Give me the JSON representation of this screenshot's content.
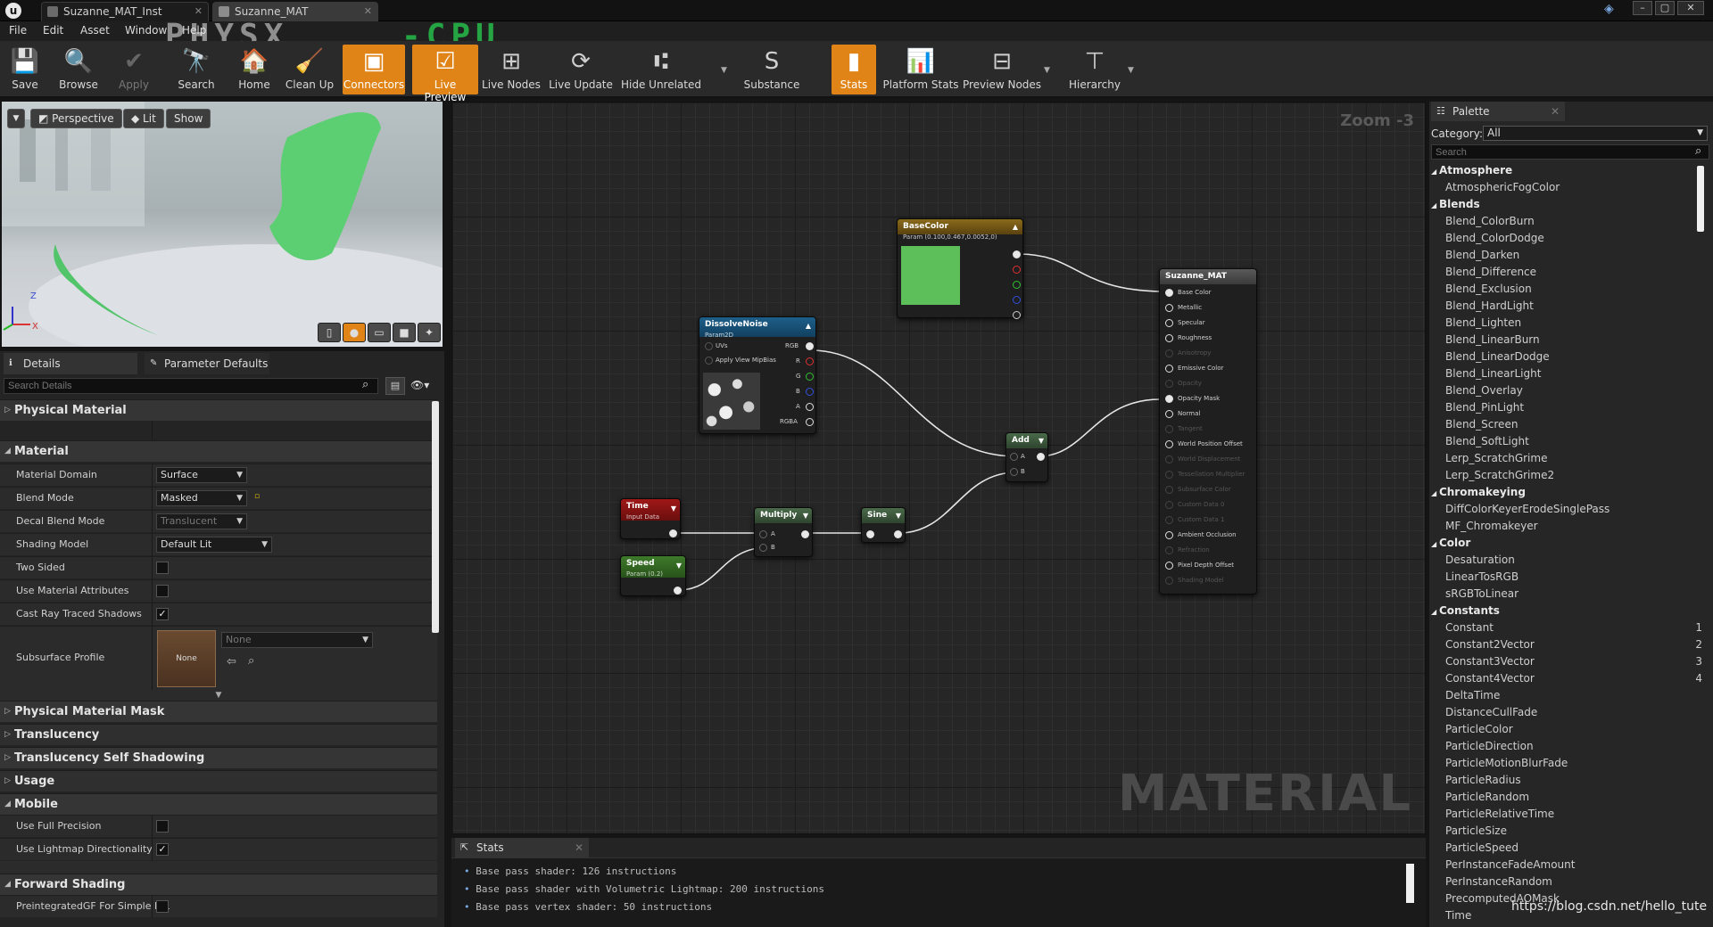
{
  "titlebar": {
    "logo": "u",
    "tabs": [
      "Suzanne_MAT_Inst",
      "Suzanne_MAT"
    ]
  },
  "menu": [
    "File",
    "Edit",
    "Asset",
    "Window",
    "Help"
  ],
  "overlay": {
    "text1": "PHYSX",
    "text2": "-CPU"
  },
  "toolbar": [
    {
      "label": "Save",
      "icon": "save-icon",
      "glyph": "💾",
      "active": false,
      "disabled": false
    },
    {
      "label": "Browse",
      "icon": "browse-icon",
      "glyph": "🔍",
      "active": false,
      "disabled": false
    },
    {
      "label": "Apply",
      "icon": "apply-icon",
      "glyph": "✔",
      "active": false,
      "disabled": true
    },
    {
      "label": "Search",
      "icon": "search-icon",
      "glyph": "🔭",
      "active": false,
      "disabled": false
    },
    {
      "label": "Home",
      "icon": "home-icon",
      "glyph": "🏠",
      "active": false,
      "disabled": false
    },
    {
      "label": "Clean Up",
      "icon": "clean-up-icon",
      "glyph": "🧹",
      "active": false,
      "disabled": false
    },
    {
      "label": "Connectors",
      "icon": "connectors-icon",
      "glyph": "▣",
      "active": true,
      "disabled": false
    },
    {
      "label": "Live Preview",
      "icon": "live-preview-icon",
      "glyph": "☑",
      "active": true,
      "disabled": false
    },
    {
      "label": "Live Nodes",
      "icon": "live-nodes-icon",
      "glyph": "⊞",
      "active": false,
      "disabled": false
    },
    {
      "label": "Live Update",
      "icon": "live-update-icon",
      "glyph": "⟳",
      "active": false,
      "disabled": false
    },
    {
      "label": "Hide Unrelated",
      "icon": "hide-unrelated-icon",
      "glyph": "⑆",
      "active": false,
      "disabled": false
    },
    {
      "label": "Substance",
      "icon": "substance-icon",
      "glyph": "S",
      "active": false,
      "disabled": false
    },
    {
      "label": "Stats",
      "icon": "stats-icon",
      "glyph": "▮",
      "active": true,
      "disabled": false
    },
    {
      "label": "Platform Stats",
      "icon": "platform-stats-icon",
      "glyph": "📊",
      "active": false,
      "disabled": false
    },
    {
      "label": "Preview Nodes",
      "icon": "preview-nodes-icon",
      "glyph": "⊟",
      "active": false,
      "disabled": false
    },
    {
      "label": "Hierarchy",
      "icon": "hierarchy-icon",
      "glyph": "⊤",
      "active": false,
      "disabled": false
    }
  ],
  "viewport": {
    "perspective": "Perspective",
    "lit": "Lit",
    "show": "Show",
    "axis_z": "Z",
    "axis_x": "X"
  },
  "details": {
    "tabs": [
      "Details",
      "Parameter Defaults"
    ],
    "search_placeholder": "Search Details",
    "physical_material": "Physical Material",
    "material": "Material",
    "props": {
      "material_domain": {
        "label": "Material Domain",
        "value": "Surface"
      },
      "blend_mode": {
        "label": "Blend Mode",
        "value": "Masked"
      },
      "decal_blend_mode": {
        "label": "Decal Blend Mode",
        "value": "Translucent"
      },
      "shading_model": {
        "label": "Shading Model",
        "value": "Default Lit"
      },
      "two_sided": {
        "label": "Two Sided",
        "checked": false
      },
      "use_material_attributes": {
        "label": "Use Material Attributes",
        "checked": false
      },
      "cast_ray_traced_shadows": {
        "label": "Cast Ray Traced Shadows",
        "checked": true
      },
      "subsurface_profile": {
        "label": "Subsurface Profile",
        "thumb": "None",
        "value": "None"
      }
    },
    "cats": [
      "Physical Material Mask",
      "Translucency",
      "Translucency Self Shadowing",
      "Usage"
    ],
    "mobile": "Mobile",
    "mobile_props": [
      {
        "label": "Use Full Precision",
        "checked": false
      },
      {
        "label": "Use Lightmap Directionality",
        "checked": true
      }
    ],
    "forward": "Forward Shading",
    "forward_prop": {
      "label": "PreintegratedGF For Simple IBL",
      "checked": false
    }
  },
  "graph": {
    "zoom": "Zoom -3",
    "watermark": "MATERIAL",
    "nodes": {
      "basecolor": {
        "title": "BaseColor",
        "sub": "Param (0.100,0.467,0.0052,0)"
      },
      "dissolve": {
        "title": "DissolveNoise",
        "sub": "Param2D",
        "inputs": [
          "UVs",
          "Apply View MipBias"
        ],
        "outputs": [
          "RGB",
          "R",
          "G",
          "B",
          "A",
          "RGBA"
        ]
      },
      "time": {
        "title": "Time",
        "sub": "Input Data"
      },
      "speed": {
        "title": "Speed",
        "sub": "Param (0.2)"
      },
      "multiply": {
        "title": "Multiply",
        "inputs": [
          "A",
          "B"
        ]
      },
      "sine": {
        "title": "Sine"
      },
      "add": {
        "title": "Add",
        "inputs": [
          "A",
          "B"
        ]
      },
      "result": {
        "title": "Suzanne_MAT",
        "inputs": [
          {
            "label": "Base Color",
            "active": true,
            "connected": true
          },
          {
            "label": "Metallic",
            "active": true,
            "connected": false
          },
          {
            "label": "Specular",
            "active": true,
            "connected": false
          },
          {
            "label": "Roughness",
            "active": true,
            "connected": false
          },
          {
            "label": "Anisotropy",
            "active": false,
            "connected": false
          },
          {
            "label": "Emissive Color",
            "active": true,
            "connected": false
          },
          {
            "label": "Opacity",
            "active": false,
            "connected": false
          },
          {
            "label": "Opacity Mask",
            "active": true,
            "connected": true
          },
          {
            "label": "Normal",
            "active": true,
            "connected": false
          },
          {
            "label": "Tangent",
            "active": false,
            "connected": false
          },
          {
            "label": "World Position Offset",
            "active": true,
            "connected": false
          },
          {
            "label": "World Displacement",
            "active": false,
            "connected": false
          },
          {
            "label": "Tessellation Multiplier",
            "active": false,
            "connected": false
          },
          {
            "label": "Subsurface Color",
            "active": false,
            "connected": false
          },
          {
            "label": "Custom Data 0",
            "active": false,
            "connected": false
          },
          {
            "label": "Custom Data 1",
            "active": false,
            "connected": false
          },
          {
            "label": "Ambient Occlusion",
            "active": true,
            "connected": false
          },
          {
            "label": "Refraction",
            "active": false,
            "connected": false
          },
          {
            "label": "Pixel Depth Offset",
            "active": true,
            "connected": false
          },
          {
            "label": "Shading Model",
            "active": false,
            "connected": false
          }
        ]
      }
    }
  },
  "stats": {
    "tab": "Stats",
    "lines": [
      "Base pass shader: 126 instructions",
      "Base pass shader with Volumetric Lightmap: 200 instructions",
      "Base pass vertex shader: 50 instructions"
    ]
  },
  "palette": {
    "tab": "Palette",
    "category_label": "Category:",
    "category_value": "All",
    "search_placeholder": "Search",
    "entries": [
      {
        "t": "c",
        "l": "Atmosphere"
      },
      {
        "t": "i",
        "l": "AtmosphericFogColor"
      },
      {
        "t": "c",
        "l": "Blends"
      },
      {
        "t": "i",
        "l": "Blend_ColorBurn"
      },
      {
        "t": "i",
        "l": "Blend_ColorDodge"
      },
      {
        "t": "i",
        "l": "Blend_Darken"
      },
      {
        "t": "i",
        "l": "Blend_Difference"
      },
      {
        "t": "i",
        "l": "Blend_Exclusion"
      },
      {
        "t": "i",
        "l": "Blend_HardLight"
      },
      {
        "t": "i",
        "l": "Blend_Lighten"
      },
      {
        "t": "i",
        "l": "Blend_LinearBurn"
      },
      {
        "t": "i",
        "l": "Blend_LinearDodge"
      },
      {
        "t": "i",
        "l": "Blend_LinearLight"
      },
      {
        "t": "i",
        "l": "Blend_Overlay"
      },
      {
        "t": "i",
        "l": "Blend_PinLight"
      },
      {
        "t": "i",
        "l": "Blend_Screen"
      },
      {
        "t": "i",
        "l": "Blend_SoftLight"
      },
      {
        "t": "i",
        "l": "Lerp_ScratchGrime"
      },
      {
        "t": "i",
        "l": "Lerp_ScratchGrime2"
      },
      {
        "t": "c",
        "l": "Chromakeying"
      },
      {
        "t": "i",
        "l": "DiffColorKeyerErodeSinglePass"
      },
      {
        "t": "i",
        "l": "MF_Chromakeyer"
      },
      {
        "t": "c",
        "l": "Color"
      },
      {
        "t": "i",
        "l": "Desaturation"
      },
      {
        "t": "i",
        "l": "LinearTosRGB"
      },
      {
        "t": "i",
        "l": "sRGBToLinear"
      },
      {
        "t": "c",
        "l": "Constants"
      },
      {
        "t": "i",
        "l": "Constant",
        "n": "1"
      },
      {
        "t": "i",
        "l": "Constant2Vector",
        "n": "2"
      },
      {
        "t": "i",
        "l": "Constant3Vector",
        "n": "3"
      },
      {
        "t": "i",
        "l": "Constant4Vector",
        "n": "4"
      },
      {
        "t": "i",
        "l": "DeltaTime"
      },
      {
        "t": "i",
        "l": "DistanceCullFade"
      },
      {
        "t": "i",
        "l": "ParticleColor"
      },
      {
        "t": "i",
        "l": "ParticleDirection"
      },
      {
        "t": "i",
        "l": "ParticleMotionBlurFade"
      },
      {
        "t": "i",
        "l": "ParticleRadius"
      },
      {
        "t": "i",
        "l": "ParticleRandom"
      },
      {
        "t": "i",
        "l": "ParticleRelativeTime"
      },
      {
        "t": "i",
        "l": "ParticleSize"
      },
      {
        "t": "i",
        "l": "ParticleSpeed"
      },
      {
        "t": "i",
        "l": "PerInstanceFadeAmount"
      },
      {
        "t": "i",
        "l": "PerInstanceRandom"
      },
      {
        "t": "i",
        "l": "PrecomputedAOMask"
      },
      {
        "t": "i",
        "l": "Time"
      }
    ]
  },
  "credit": "https://blog.csdn.net/hello_tute",
  "colors": {
    "accent": "#e08418",
    "basecolor_swatch": "#5cbf5a"
  }
}
